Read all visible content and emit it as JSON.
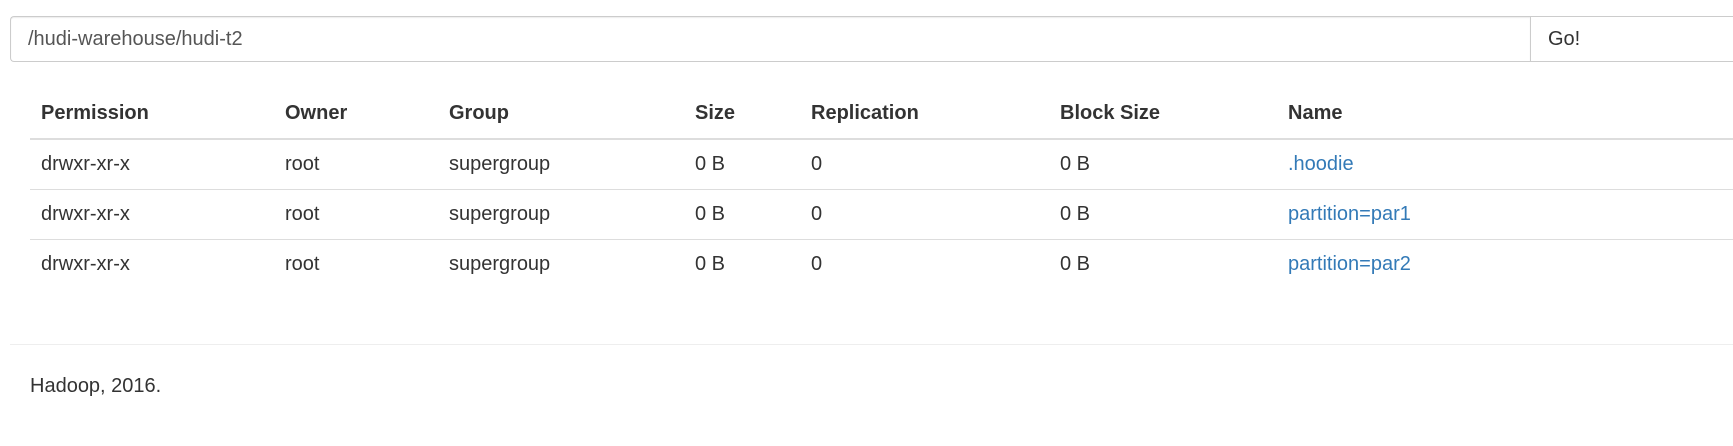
{
  "path_bar": {
    "path_value": "/hudi-warehouse/hudi-t2",
    "go_label": "Go!"
  },
  "table": {
    "headers": [
      "Permission",
      "Owner",
      "Group",
      "Size",
      "Replication",
      "Block Size",
      "Name"
    ],
    "rows": [
      {
        "permission": "drwxr-xr-x",
        "owner": "root",
        "group": "supergroup",
        "size": "0 B",
        "replication": "0",
        "block_size": "0 B",
        "name": ".hoodie"
      },
      {
        "permission": "drwxr-xr-x",
        "owner": "root",
        "group": "supergroup",
        "size": "0 B",
        "replication": "0",
        "block_size": "0 B",
        "name": "partition=par1"
      },
      {
        "permission": "drwxr-xr-x",
        "owner": "root",
        "group": "supergroup",
        "size": "0 B",
        "replication": "0",
        "block_size": "0 B",
        "name": "partition=par2"
      }
    ]
  },
  "footer": {
    "text": "Hadoop, 2016."
  },
  "colors": {
    "link": "#337ab7",
    "text": "#333333",
    "border": "#dddddd"
  }
}
